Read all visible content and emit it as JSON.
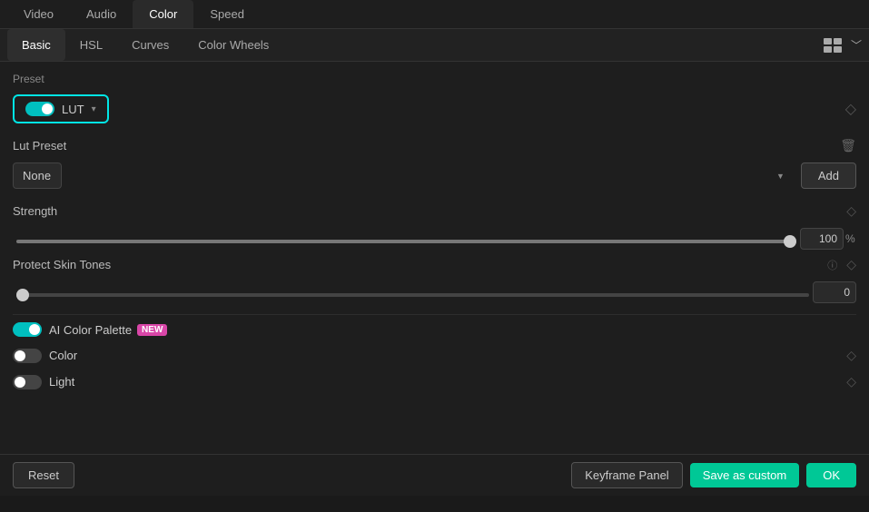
{
  "topTabs": {
    "tabs": [
      {
        "id": "video",
        "label": "Video",
        "active": false
      },
      {
        "id": "audio",
        "label": "Audio",
        "active": false
      },
      {
        "id": "color",
        "label": "Color",
        "active": true
      },
      {
        "id": "speed",
        "label": "Speed",
        "active": false
      }
    ]
  },
  "subTabs": {
    "tabs": [
      {
        "id": "basic",
        "label": "Basic",
        "active": true
      },
      {
        "id": "hsl",
        "label": "HSL",
        "active": false
      },
      {
        "id": "curves",
        "label": "Curves",
        "active": false
      },
      {
        "id": "colorwheels",
        "label": "Color Wheels",
        "active": false
      }
    ]
  },
  "preset": {
    "label": "Preset",
    "lut": {
      "toggle_label": "LUT",
      "dropdown_arrow": "▾"
    }
  },
  "lutPreset": {
    "label": "Lut Preset",
    "value": "None",
    "add_label": "Add",
    "placeholder": "None"
  },
  "strength": {
    "label": "Strength",
    "value": 100,
    "unit": "%",
    "min": 0,
    "max": 100
  },
  "protectSkinTones": {
    "label": "Protect Skin Tones",
    "value": 0,
    "min": 0,
    "max": 100
  },
  "aiColorPalette": {
    "label": "AI Color Palette",
    "badge": "NEW",
    "enabled": true
  },
  "color": {
    "label": "Color",
    "enabled": false
  },
  "light": {
    "label": "Light",
    "enabled": false
  },
  "footer": {
    "reset_label": "Reset",
    "keyframe_label": "Keyframe Panel",
    "save_custom_label": "Save as custom",
    "ok_label": "OK"
  },
  "icons": {
    "diamond": "◇",
    "trash": "🗑",
    "info": "ⓘ",
    "chevron_down": "﹀",
    "view": "⊞"
  }
}
